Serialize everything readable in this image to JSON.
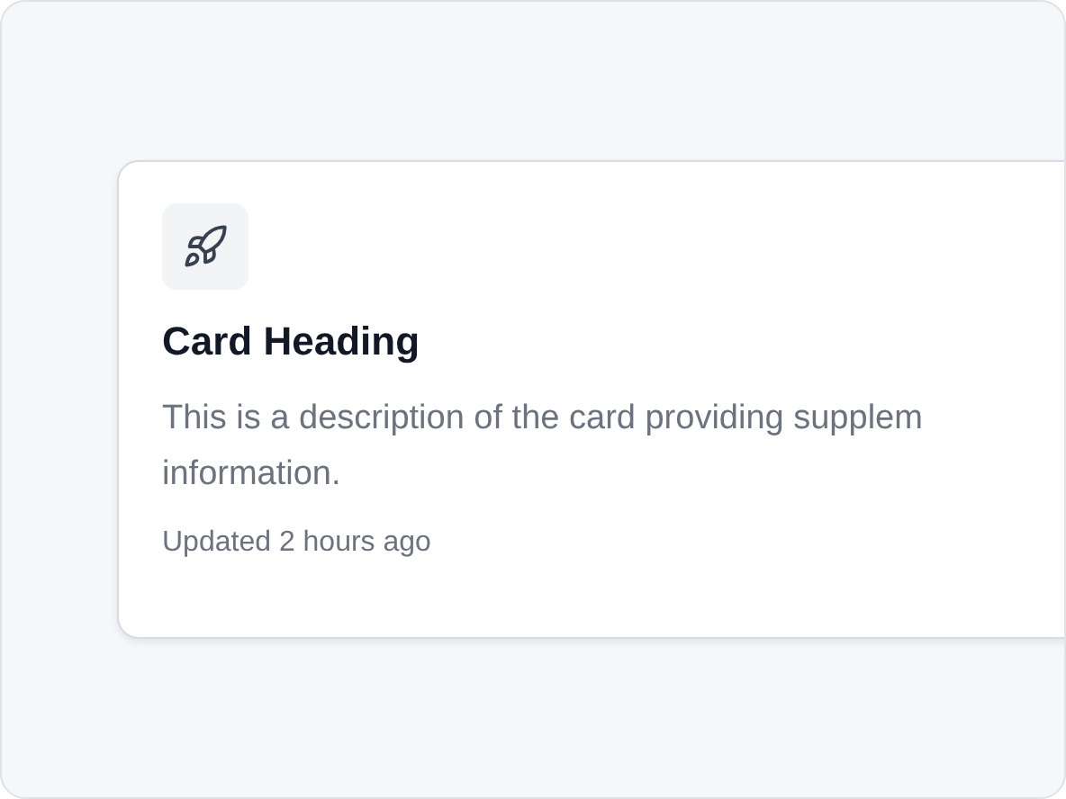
{
  "card": {
    "heading": "Card Heading",
    "description_lines": [
      "This is a description of the card providing supplem",
      "information."
    ],
    "meta": "Updated 2 hours ago"
  }
}
